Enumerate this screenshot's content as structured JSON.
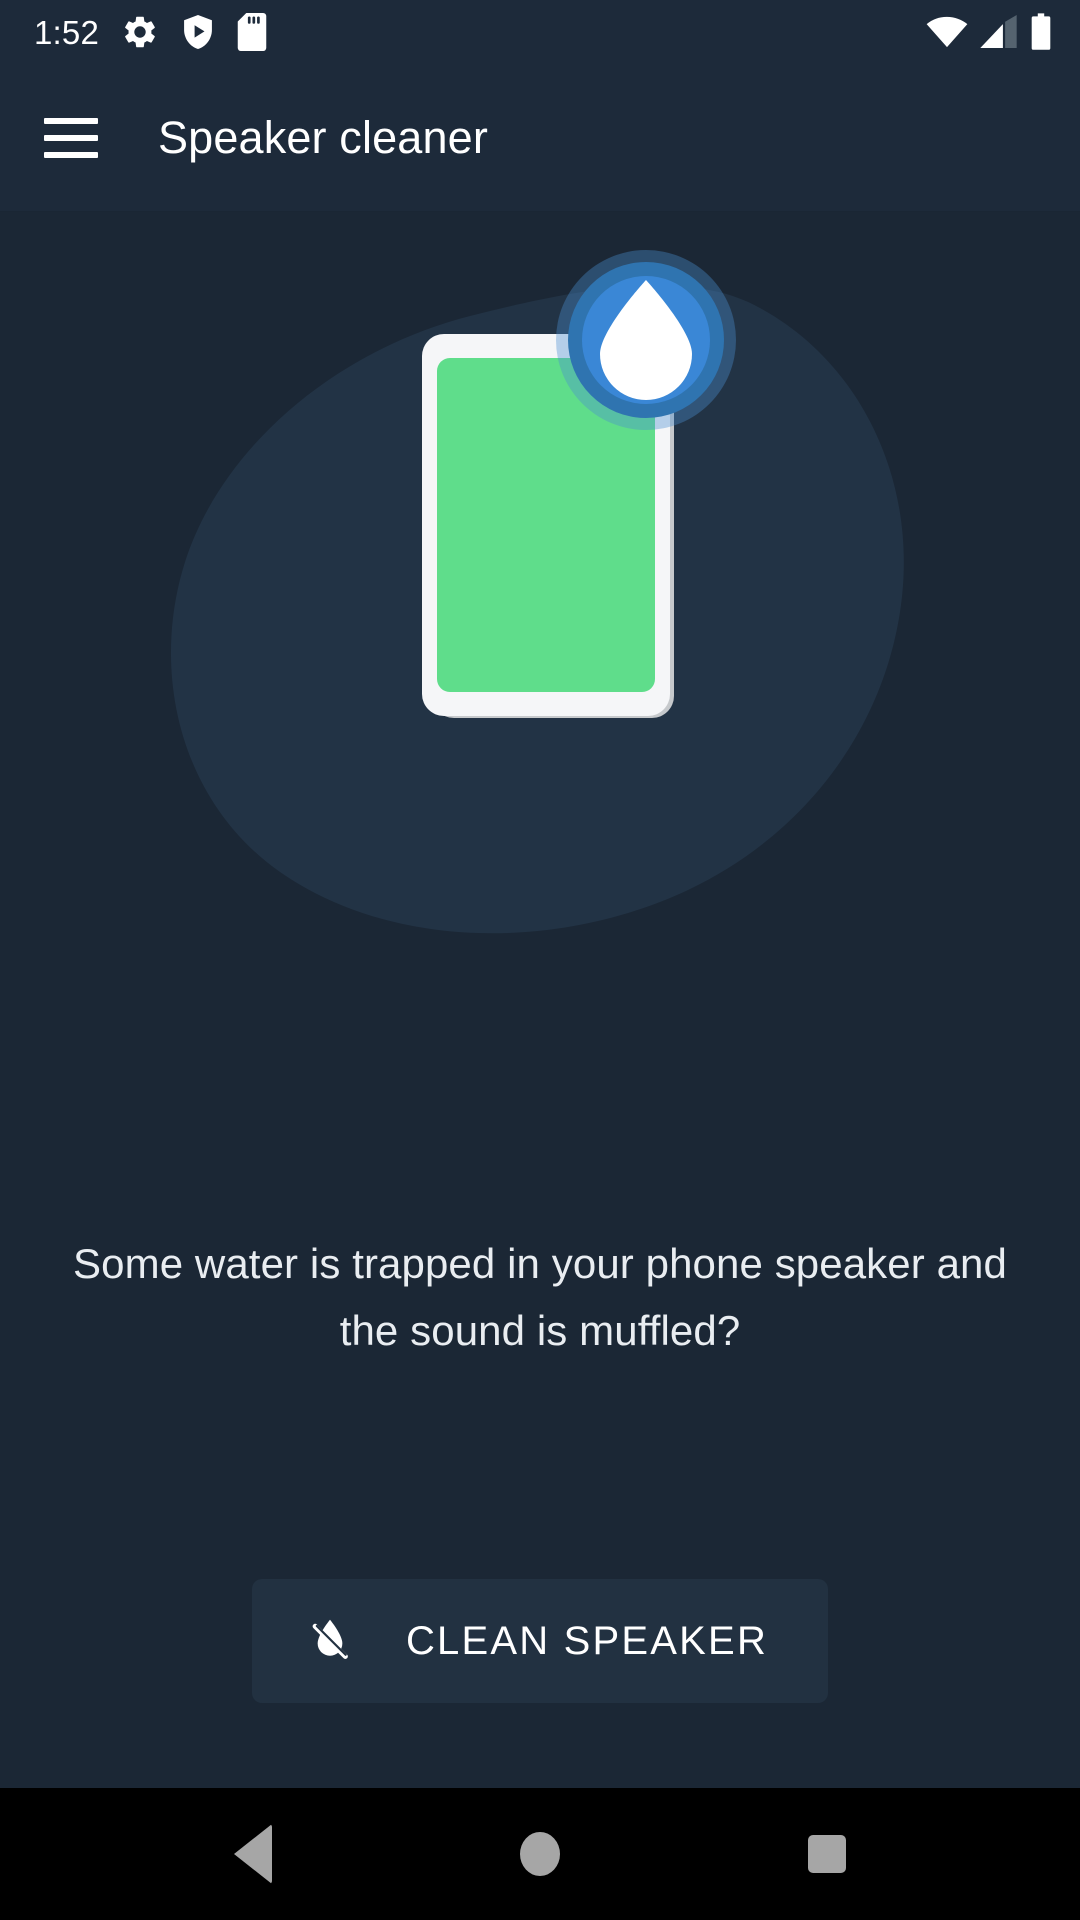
{
  "theme": {
    "background": "#1b2735",
    "appbar_background": "#1d2a3a",
    "blob": "#223345",
    "accent_blue": "#2d7dc4",
    "accent_blue_ring": "#3a87c9",
    "screen_green": "#5fdd8b",
    "phone_body": "#f5f6f8",
    "phone_shadow": "#c6c9cc",
    "button_background": "#223141",
    "text_primary": "#ffffff",
    "text_body": "#e9edf1",
    "navbar_background": "#000000",
    "navbar_icon": "#a6a6a6"
  },
  "status_bar": {
    "clock": "1:52",
    "left_icons": [
      {
        "name": "settings-gear-icon",
        "glyph": "gear"
      },
      {
        "name": "play-protect-shield-icon",
        "glyph": "shield-play"
      },
      {
        "name": "sd-card-icon",
        "glyph": "sd-card"
      }
    ],
    "right_icons": [
      {
        "name": "wifi-icon",
        "glyph": "wifi",
        "state": "full"
      },
      {
        "name": "cellular-signal-icon",
        "glyph": "signal",
        "state": "2-of-4-bars"
      },
      {
        "name": "battery-icon",
        "glyph": "battery",
        "state": "full"
      }
    ]
  },
  "app_bar": {
    "menu_icon": "hamburger-menu-icon",
    "title": "Speaker cleaner"
  },
  "hero": {
    "illustration_name": "phone-with-water-drop-illustration",
    "phone_screen_color": "#5fdd8b",
    "droplet_badge_name": "water-drop-badge"
  },
  "main": {
    "headline": "Some water is trapped in your phone speaker and the sound is muffled?",
    "primary_button": {
      "label": "CLEAN SPEAKER",
      "icon": "no-water-drop-icon"
    }
  },
  "nav_bar": {
    "buttons": [
      {
        "name": "nav-back-button",
        "label": "Back"
      },
      {
        "name": "nav-home-button",
        "label": "Home"
      },
      {
        "name": "nav-recents-button",
        "label": "Recents"
      }
    ]
  }
}
